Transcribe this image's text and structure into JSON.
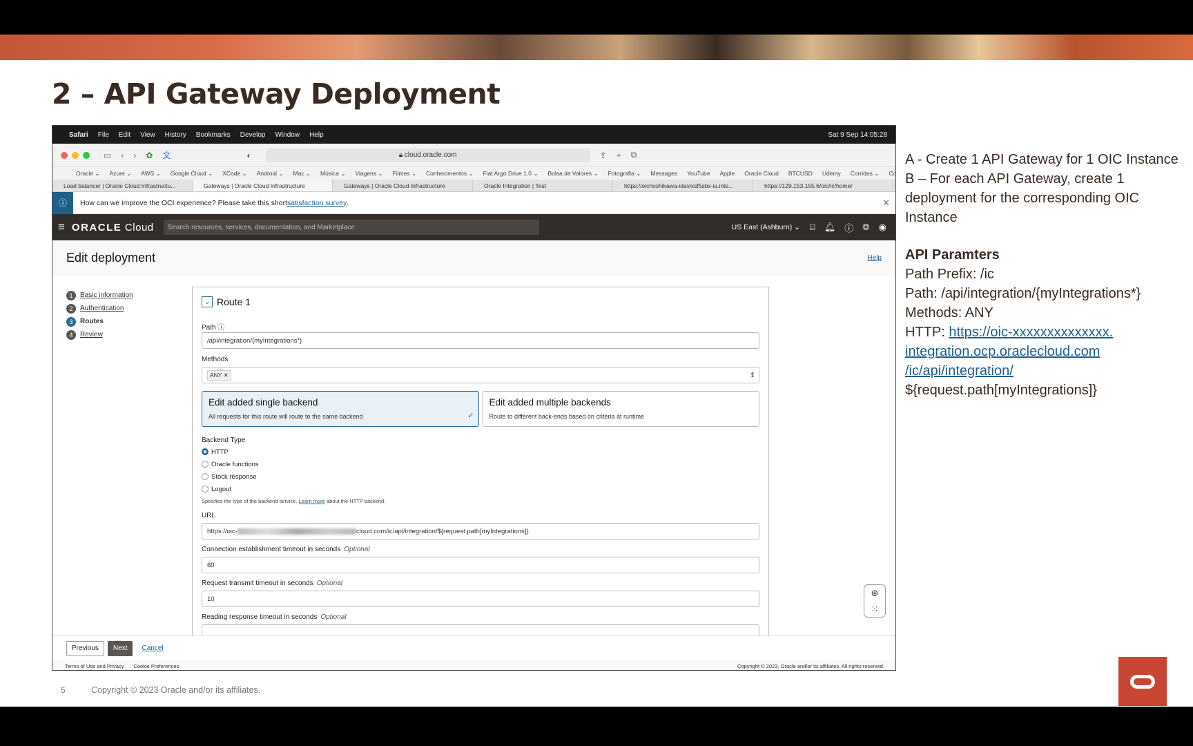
{
  "slide": {
    "title": "2 – API Gateway Deployment",
    "page_number": "5",
    "copyright": "Copyright © 2023 Oracle and/or its affiliates."
  },
  "mac_menu": [
    "Safari",
    "File",
    "Edit",
    "View",
    "History",
    "Bookmarks",
    "Develop",
    "Window",
    "Help"
  ],
  "mac_clock": "Sat 9 Sep  14:05:28",
  "browser": {
    "url": "cloud.oracle.com",
    "bookmarks": [
      "Oracle ⌄",
      "Azure ⌄",
      "AWS ⌄",
      "Google Cloud ⌄",
      "XCode ⌄",
      "Android ⌄",
      "Mac ⌄",
      "Música ⌄",
      "Viagens ⌄",
      "Filmes ⌄",
      "Conhecimentos ⌄",
      "Fiat Argo Drive 1.0 ⌄",
      "Bolsa de Valores ⌄",
      "Fotografia ⌄",
      "Messages",
      "YouTube",
      "Apple",
      "Oracle Cloud",
      "BTCUSD",
      "Udemy",
      "Corridas ⌄",
      "Correios"
    ],
    "tabs": [
      "Load balancer | Oracle Cloud Infrastructu...",
      "Gateways | Oracle Cloud Infrastructure",
      "Gateways | Oracle Cloud Infrastructure",
      "Oracle Integration | Test",
      "https://oichoshikawa-idavixsf5sbx-ia.inte...",
      "https://129.153.155.6/oic/ic/home/"
    ]
  },
  "notice": {
    "text": "How can we improve the OCI experience? Please take this short ",
    "link": "satisfaction survey",
    "end": "."
  },
  "oci": {
    "logo_a": "ORACLE",
    "logo_b": " Cloud",
    "search_placeholder": "Search resources, services, documentation, and Marketplace",
    "region": "US East (Ashburn) ⌄"
  },
  "page": {
    "title": "Edit deployment",
    "help": "Help",
    "steps": [
      {
        "n": "1",
        "label": "Basic information"
      },
      {
        "n": "2",
        "label": "Authentication"
      },
      {
        "n": "3",
        "label": "Routes"
      },
      {
        "n": "4",
        "label": "Review"
      }
    ]
  },
  "route": {
    "title": "Route 1",
    "path_label": "Path",
    "path_value": "/api/integration/{myIntegrations*}",
    "methods_label": "Methods",
    "method_chip": "ANY",
    "single": {
      "title": "Edit added single backend",
      "desc": "All requests for this route will route to the same backend"
    },
    "multiple": {
      "title": "Edit added multiple backends",
      "desc": "Route to different back-ends based on criteria at runtime"
    },
    "backend_type_label": "Backend Type",
    "backend_types": [
      "HTTP",
      "Oracle functions",
      "Stock response",
      "Logout"
    ],
    "hint_a": "Specifies the type of the backend service. ",
    "hint_link": "Learn more",
    "hint_b": " about the HTTP backend.",
    "url_label": "URL",
    "url_start": "https://oic-",
    "url_end": "cloud.com/ic/api/integration/${request.path[myIntegrations]}",
    "conn_label": "Connection establishment timeout in seconds",
    "conn_value": "60",
    "req_label": "Request transmit timeout in seconds",
    "req_value": "10",
    "read_label": "Reading response timeout in seconds",
    "optional": "Optional"
  },
  "footer": {
    "previous": "Previous",
    "next": "Next",
    "cancel": "Cancel",
    "terms": "Terms of Use and Privacy",
    "cookies": "Cookie Preferences",
    "copyright": "Copyright © 2023, Oracle and/or its affiliates. All rights reserved."
  },
  "notes": {
    "a": "A - Create 1 API Gateway for 1 OIC Instance",
    "b": "B – For each API Gateway, create 1 deployment for the corresponding OIC Instance",
    "params_title": "API Paramters",
    "prefix": "Path Prefix: /ic",
    "path": "Path: /api/integration/{myIntegrations*}",
    "methods": "Methods: ANY",
    "http_label": "HTTP: ",
    "http_link_1": "https://oic-xxxxxxxxxxxxxx.",
    "http_link_2": "integration.ocp.oraclecloud.com",
    "http_link_3": "/ic/api/integration/",
    "http_tail": "${request.path[myIntegrations]}"
  },
  "colors": {
    "oracle_red": "#c74634",
    "oci_dark": "#312d2a",
    "accent_blue": "#2b6a97",
    "title_brown": "#3a2b22"
  }
}
